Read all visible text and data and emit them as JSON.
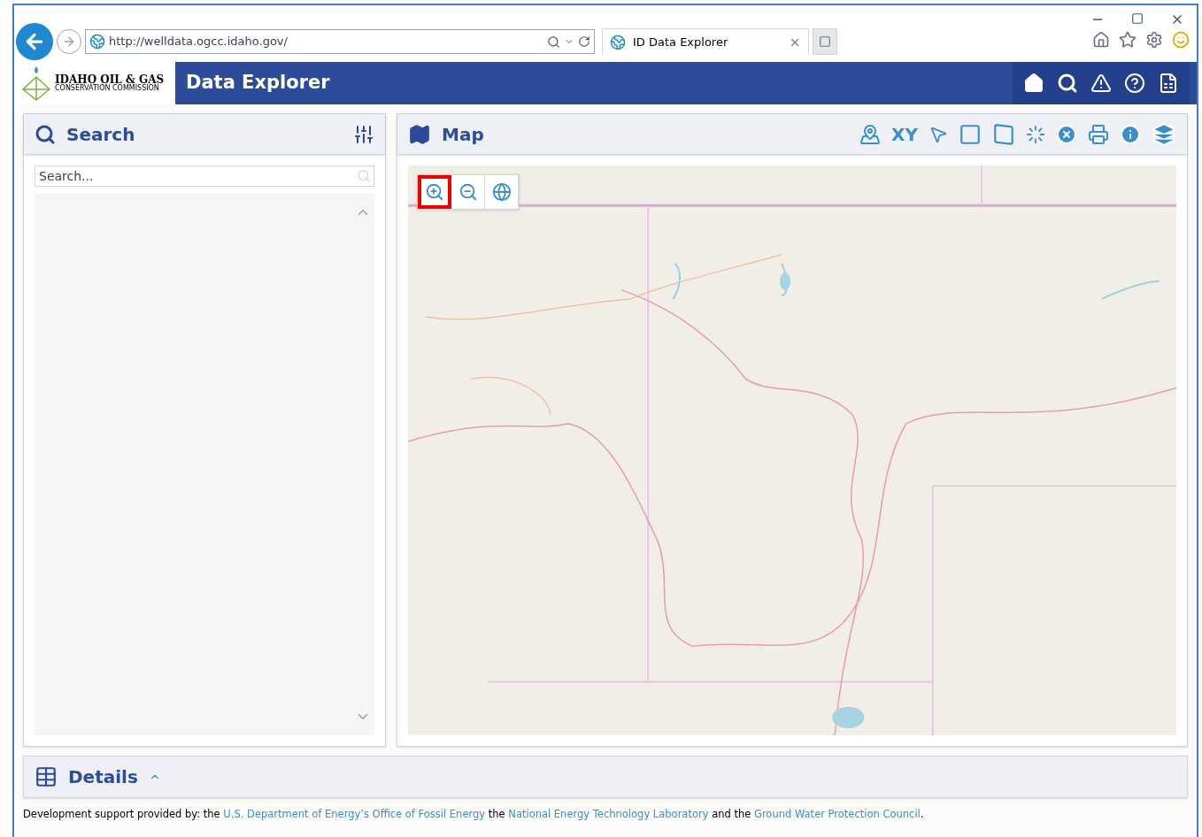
{
  "browser": {
    "url": "http://welldata.ogcc.idaho.gov/",
    "tab_title": "ID Data Explorer"
  },
  "header": {
    "logo_title": "IDAHO OIL & GAS",
    "logo_subtitle": "CONSERVATION COMMISSION",
    "title": "Data Explorer"
  },
  "search_panel": {
    "title": "Search",
    "placeholder": "Search..."
  },
  "map_panel": {
    "title": "Map",
    "xy_label": "XY",
    "map_controls": [
      {
        "kind": "zoom-in",
        "selected": true
      },
      {
        "kind": "zoom-out",
        "selected": false
      },
      {
        "kind": "globe",
        "selected": false
      }
    ]
  },
  "details_panel": {
    "title": "Details"
  },
  "footer": [
    {
      "text": "Development support provided by: the",
      "link": false
    },
    {
      "text": "U.S. Department of Energy’s Office of Fossil Energy",
      "link": true
    },
    {
      "text": "the",
      "link": false
    },
    {
      "text": "National Energy Technology Laboratory",
      "link": true
    },
    {
      "text": "and the",
      "link": false
    },
    {
      "text": "Ground Water Protection Council",
      "link": true
    },
    {
      "text": ".",
      "link": false
    }
  ]
}
